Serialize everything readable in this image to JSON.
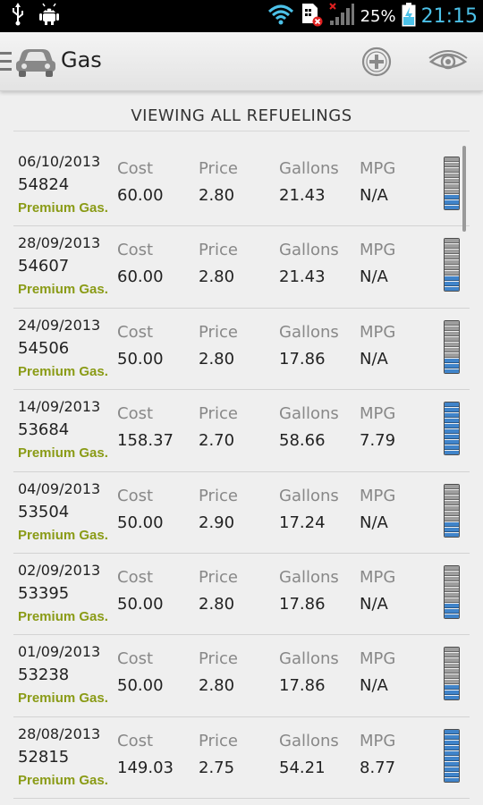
{
  "status_bar": {
    "battery_percent": "25%",
    "time": "21:15",
    "icons": [
      "usb-icon",
      "android-debug-icon",
      "wifi-icon",
      "sim-blocked-icon",
      "signal-no-service-icon",
      "battery-charging-icon"
    ]
  },
  "action_bar": {
    "title": "Gas",
    "icons": [
      "menu-icon",
      "car-icon",
      "add-circle-icon",
      "eye-icon"
    ]
  },
  "section_header": "VIEWING ALL REFUELINGS",
  "columns": {
    "cost": "Cost",
    "price": "Price",
    "gallons": "Gallons",
    "mpg": "MPG"
  },
  "colors": {
    "fuel_type": "#8a9b16",
    "gauge_full": "#3a78b8",
    "gauge_empty": "#9e9e9e",
    "time": "#4cc1e8"
  },
  "refuelings": [
    {
      "date": "06/10/2013",
      "odometer": "54824",
      "fuel": "Premium Gas.",
      "cost": "60.00",
      "price": "2.80",
      "gallons": "21.43",
      "mpg": "N/A",
      "tank_fill": 0.3
    },
    {
      "date": "28/09/2013",
      "odometer": "54607",
      "fuel": "Premium Gas.",
      "cost": "60.00",
      "price": "2.80",
      "gallons": "21.43",
      "mpg": "N/A",
      "tank_fill": 0.3
    },
    {
      "date": "24/09/2013",
      "odometer": "54506",
      "fuel": "Premium Gas.",
      "cost": "50.00",
      "price": "2.80",
      "gallons": "17.86",
      "mpg": "N/A",
      "tank_fill": 0.3
    },
    {
      "date": "14/09/2013",
      "odometer": "53684",
      "fuel": "Premium Gas.",
      "cost": "158.37",
      "price": "2.70",
      "gallons": "58.66",
      "mpg": "7.79",
      "tank_fill": 1.0
    },
    {
      "date": "04/09/2013",
      "odometer": "53504",
      "fuel": "Premium Gas.",
      "cost": "50.00",
      "price": "2.90",
      "gallons": "17.24",
      "mpg": "N/A",
      "tank_fill": 0.3
    },
    {
      "date": "02/09/2013",
      "odometer": "53395",
      "fuel": "Premium Gas.",
      "cost": "50.00",
      "price": "2.80",
      "gallons": "17.86",
      "mpg": "N/A",
      "tank_fill": 0.3
    },
    {
      "date": "01/09/2013",
      "odometer": "53238",
      "fuel": "Premium Gas.",
      "cost": "50.00",
      "price": "2.80",
      "gallons": "17.86",
      "mpg": "N/A",
      "tank_fill": 0.3
    },
    {
      "date": "28/08/2013",
      "odometer": "52815",
      "fuel": "Premium Gas.",
      "cost": "149.03",
      "price": "2.75",
      "gallons": "54.21",
      "mpg": "8.77",
      "tank_fill": 1.0
    }
  ]
}
